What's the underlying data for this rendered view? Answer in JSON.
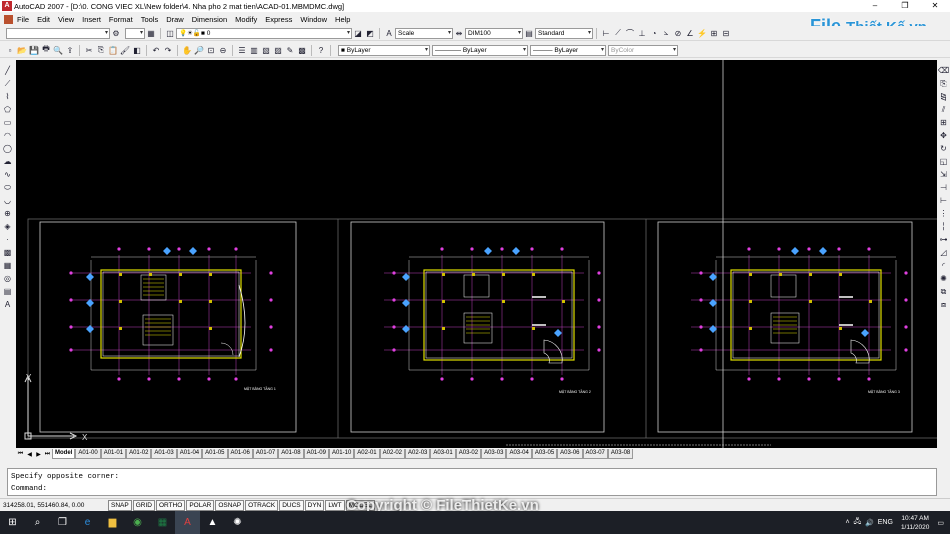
{
  "window": {
    "title": "AutoCAD 2007 - [D:\\0. CONG VIEC XL\\New folder\\4. Nha pho 2 mat tien\\ACAD-01.MBMDMC.dwg]",
    "min": "–",
    "max": "❐",
    "close": "✕"
  },
  "menu": [
    "File",
    "Edit",
    "View",
    "Insert",
    "Format",
    "Tools",
    "Draw",
    "Dimension",
    "Modify",
    "Express",
    "Window",
    "Help"
  ],
  "toolbar1": {
    "layer_current": "0",
    "textstyle": "Scale",
    "dimstyle": "DIM100",
    "tablestyle": "Standard"
  },
  "toolbar2": {
    "layer": "ByLayer",
    "linetype": "ByLayer",
    "lineweight": "ByLayer",
    "plotstyle": "ByColor"
  },
  "logo": {
    "part1": "File",
    "part2": "Thiết Kế",
    "part3": ".vn"
  },
  "drawings": [
    {
      "title": "MẶT BẰNG TẦNG 1"
    },
    {
      "title": "MẶT BẰNG TẦNG 2"
    },
    {
      "title": "MẶT BẰNG TẦNG 3"
    }
  ],
  "ucs": {
    "x": "X",
    "y": "Y"
  },
  "tabs": [
    "Model",
    "A01-00",
    "A01-01",
    "A01-02",
    "A01-03",
    "A01-04",
    "A01-05",
    "A01-06",
    "A01-07",
    "A01-08",
    "A01-09",
    "A01-10",
    "A02-01",
    "A02-02",
    "A02-03",
    "A03-01",
    "A03-02",
    "A03-03",
    "A03-04",
    "A03-05",
    "A03-06",
    "A03-07",
    "A03-08"
  ],
  "command": {
    "line1": "Specify opposite corner:",
    "line2": "Command:"
  },
  "status": {
    "coords": "314258.01, 551460.84, 0.00",
    "buttons": [
      "SNAP",
      "GRID",
      "ORTHO",
      "POLAR",
      "OSNAP",
      "OTRACK",
      "DUCS",
      "DYN",
      "LWT",
      "MODEL"
    ]
  },
  "watermark": "Copyright © FileThietKe.vn",
  "taskbar": {
    "time": "10:47 AM",
    "date": "1/11/2020",
    "lang": "ENG"
  }
}
